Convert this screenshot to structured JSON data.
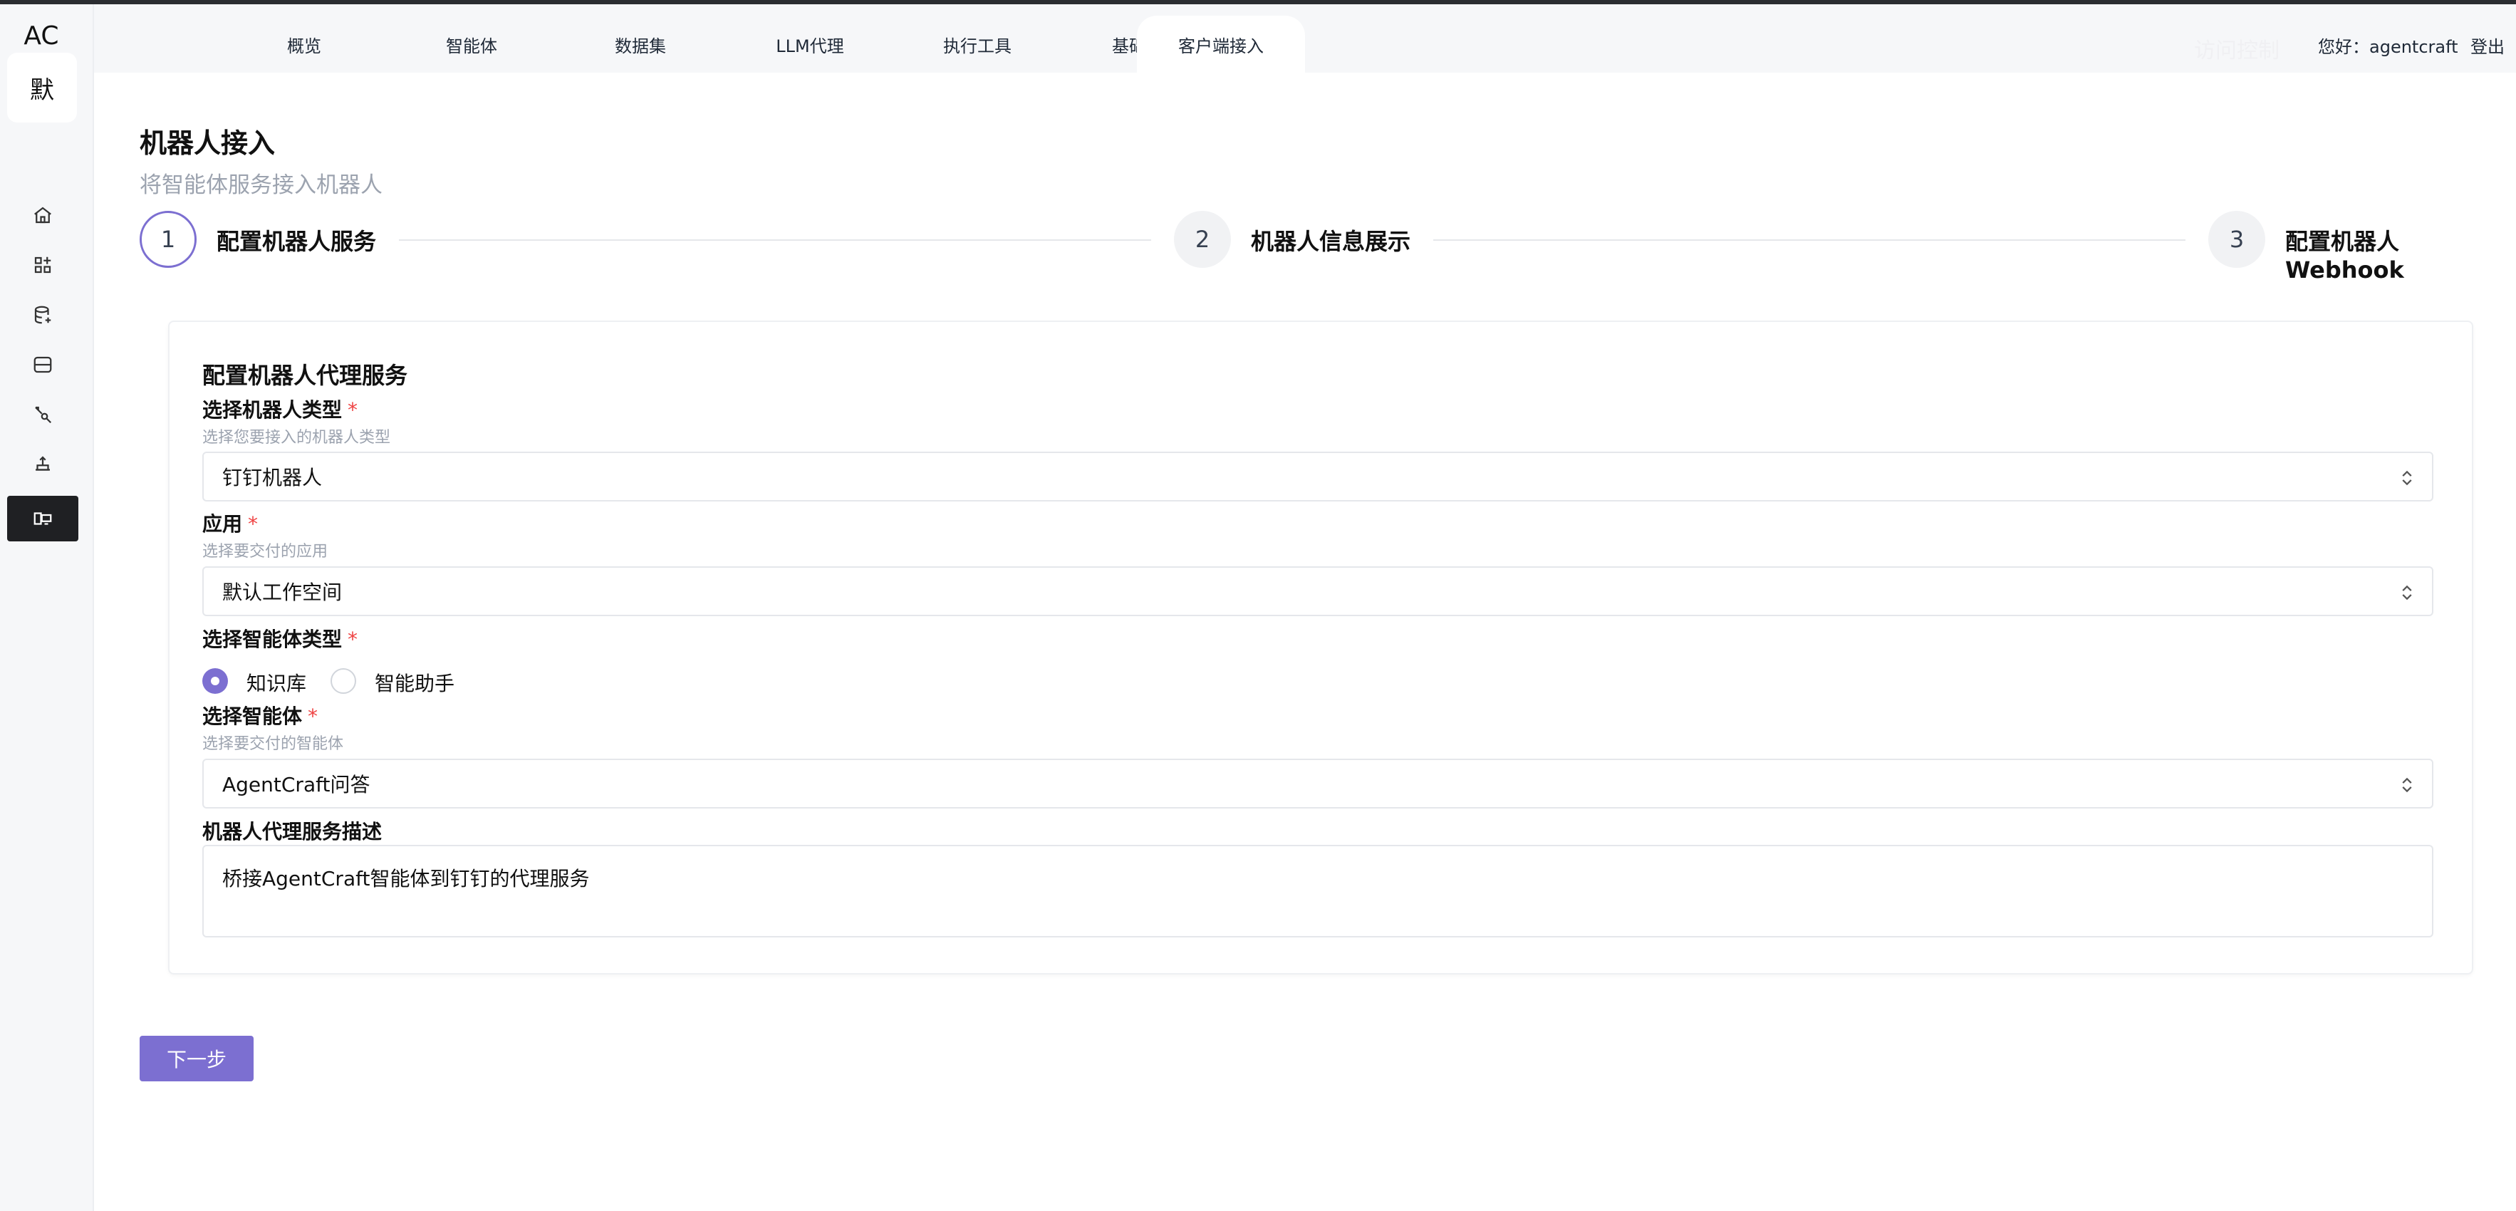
{
  "app": {
    "logo": "AC",
    "workspace_badge": "默"
  },
  "topnav": {
    "tabs": [
      {
        "label": "概览"
      },
      {
        "label": "智能体"
      },
      {
        "label": "数据集"
      },
      {
        "label": "LLM代理"
      },
      {
        "label": "执行工具"
      },
      {
        "label": "基础模型"
      },
      {
        "label": "客户端接入",
        "active": true
      }
    ],
    "faded_text": "访问控制",
    "greeting": "您好：agentcraft",
    "logout": "登出"
  },
  "sidebar": {
    "icons": [
      {
        "name": "home-icon"
      },
      {
        "name": "apps-icon"
      },
      {
        "name": "database-icon"
      },
      {
        "name": "storage-icon"
      },
      {
        "name": "tool-icon"
      },
      {
        "name": "model-icon"
      },
      {
        "name": "client-access-icon",
        "active": true
      }
    ]
  },
  "page": {
    "title": "机器人接入",
    "subtitle": "将智能体服务接入机器人"
  },
  "steps": [
    {
      "number": "1",
      "label": "配置机器人服务"
    },
    {
      "number": "2",
      "label": "机器人信息展示"
    },
    {
      "number": "3",
      "label": "配置机器人Webhook"
    }
  ],
  "form": {
    "section_title": "配置机器人代理服务",
    "robot_type": {
      "label": "选择机器人类型",
      "required": "*",
      "hint": "选择您要接入的机器人类型",
      "value": "钉钉机器人"
    },
    "app": {
      "label": "应用",
      "required": "*",
      "hint": "选择要交付的应用",
      "value": "默认工作空间"
    },
    "agent_type": {
      "label": "选择智能体类型",
      "required": "*",
      "options": [
        "知识库",
        "智能助手"
      ],
      "selected": "知识库"
    },
    "agent": {
      "label": "选择智能体",
      "required": "*",
      "hint": "选择要交付的智能体",
      "value": "AgentCraft问答"
    },
    "description": {
      "label": "机器人代理服务描述",
      "value": "桥接AgentCraft智能体到钉钉的代理服务"
    }
  },
  "actions": {
    "next_label": "下一步"
  },
  "colors": {
    "accent": "#7c6fd1",
    "required": "#ef4444",
    "active_nav": "#1f2023"
  }
}
